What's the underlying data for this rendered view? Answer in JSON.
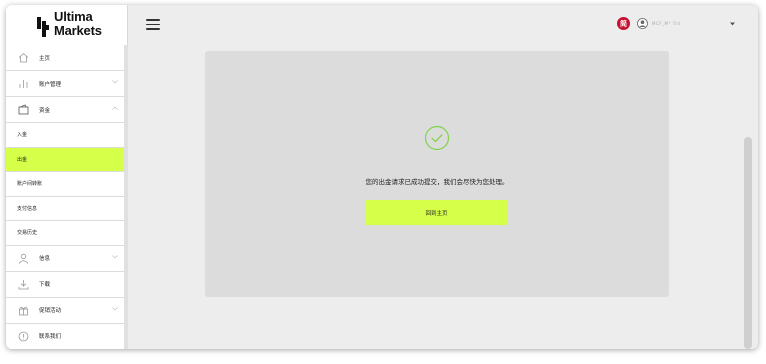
{
  "brand": {
    "line1": "Ultima",
    "line2": "Markets",
    "logo_icon": "ultima-markets-logo"
  },
  "sidebar": {
    "items": [
      {
        "label": "主页",
        "icon": "home-icon",
        "chevron": false
      },
      {
        "label": "账户管理",
        "icon": "bar-chart-icon",
        "chevron": true
      },
      {
        "label": "资金",
        "icon": "wallet-icon",
        "chevron": true,
        "expanded": true
      }
    ],
    "subitems": [
      {
        "label": "入金",
        "active": false
      },
      {
        "label": "出金",
        "active": true
      },
      {
        "label": "账户间转账",
        "active": false
      },
      {
        "label": "支付信息",
        "active": false
      },
      {
        "label": "交易历史",
        "active": false
      }
    ],
    "items_after": [
      {
        "label": "信息",
        "icon": "user-icon",
        "chevron": true
      },
      {
        "label": "下载",
        "icon": "download-icon",
        "chevron": false
      },
      {
        "label": "促销活动",
        "icon": "gift-icon",
        "chevron": true
      },
      {
        "label": "联系我们",
        "icon": "info-icon",
        "chevron": false
      }
    ]
  },
  "header": {
    "menu_icon": "hamburger-menu-icon",
    "language_badge": "简",
    "username": "MCF_M* Trd",
    "user_menu_icon": "chevron-down-icon"
  },
  "main": {
    "status_icon": "check-circle-icon",
    "message": "您的出金请求已成功提交，我们会尽快为您处理。",
    "button_label": "回到主页"
  },
  "colors": {
    "accent": "#d6ff4a",
    "success": "#7fd34a",
    "language_badge": "#c8102e"
  }
}
